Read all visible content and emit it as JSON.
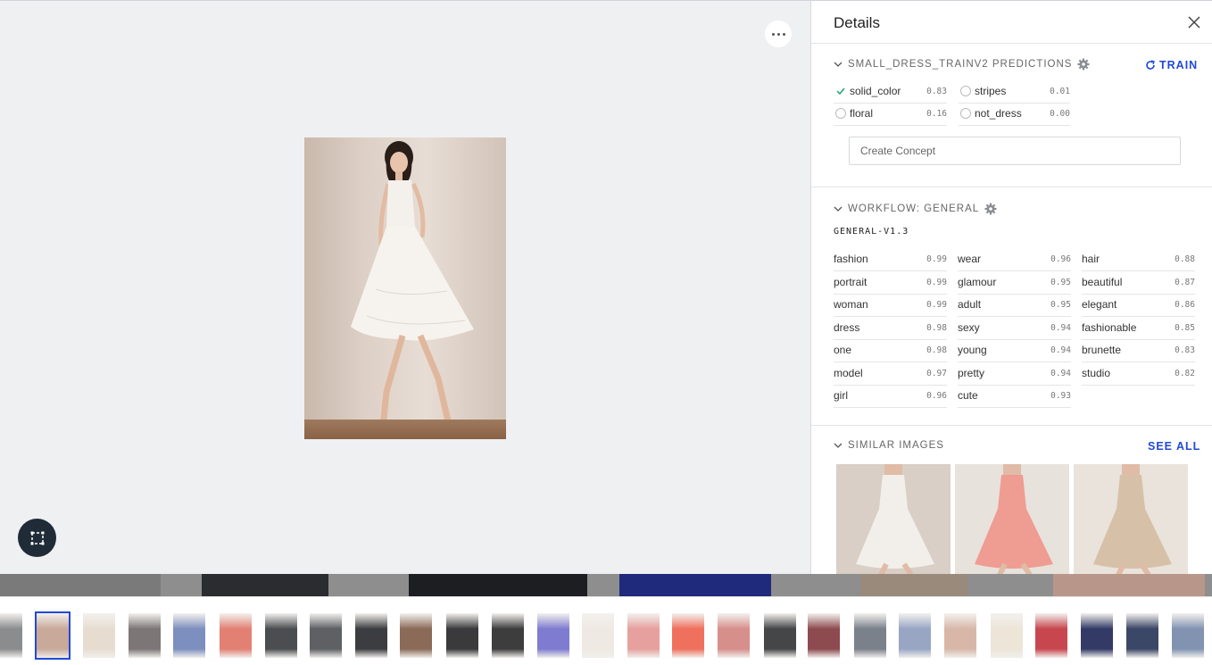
{
  "panel": {
    "title": "Details"
  },
  "predictions": {
    "header": "SMALL_DRESS_TRAINV2 PREDICTIONS",
    "train_label": "TRAIN",
    "items": [
      {
        "label": "solid_color",
        "value": "0.83",
        "checked": true
      },
      {
        "label": "stripes",
        "value": "0.01",
        "checked": false
      },
      {
        "label": "floral",
        "value": "0.16",
        "checked": false
      },
      {
        "label": "not_dress",
        "value": "0.00",
        "checked": false
      }
    ],
    "create_placeholder": "Create Concept"
  },
  "workflow": {
    "header": "WORKFLOW: GENERAL",
    "model": "GENERAL-V1.3",
    "columns": [
      [
        {
          "label": "fashion",
          "value": "0.99"
        },
        {
          "label": "portrait",
          "value": "0.99"
        },
        {
          "label": "woman",
          "value": "0.99"
        },
        {
          "label": "dress",
          "value": "0.98"
        },
        {
          "label": "one",
          "value": "0.98"
        },
        {
          "label": "model",
          "value": "0.97"
        },
        {
          "label": "girl",
          "value": "0.96"
        }
      ],
      [
        {
          "label": "wear",
          "value": "0.96"
        },
        {
          "label": "glamour",
          "value": "0.95"
        },
        {
          "label": "adult",
          "value": "0.95"
        },
        {
          "label": "sexy",
          "value": "0.94"
        },
        {
          "label": "young",
          "value": "0.94"
        },
        {
          "label": "pretty",
          "value": "0.94"
        },
        {
          "label": "cute",
          "value": "0.93"
        }
      ],
      [
        {
          "label": "hair",
          "value": "0.88"
        },
        {
          "label": "beautiful",
          "value": "0.87"
        },
        {
          "label": "elegant",
          "value": "0.86"
        },
        {
          "label": "fashionable",
          "value": "0.85"
        },
        {
          "label": "brunette",
          "value": "0.83"
        },
        {
          "label": "studio",
          "value": "0.82"
        }
      ]
    ]
  },
  "similar": {
    "header": "SIMILAR IMAGES",
    "see_all_label": "SEE ALL",
    "images": [
      {
        "icon": "white-lace-dress-photo",
        "bg": "#d9cfc6",
        "dress": "#f2efea"
      },
      {
        "icon": "pink-print-dress-photo",
        "bg": "#e8e2dc",
        "dress": "#ef9c93"
      },
      {
        "icon": "floral-lace-dress-photo",
        "bg": "#e9e3dc",
        "dress": "#d6c1a8"
      }
    ]
  },
  "colors": {
    "accent": "#2249d6",
    "check": "#1aa67a",
    "crop_button": "#1f2b37"
  },
  "filmstrip": {
    "selected_index": 1,
    "items": [
      {
        "icon": "gray-shoe-thumb",
        "color": "#8a8c8e"
      },
      {
        "icon": "white-dress-thumb",
        "color": "#c9a99a"
      },
      {
        "icon": "cream-dress-thumb",
        "color": "#e6ddd0"
      },
      {
        "icon": "pale-pink-dress-thumb",
        "color": "#7c7776"
      },
      {
        "icon": "blue-print-dress-thumb",
        "color": "#7d8fbf"
      },
      {
        "icon": "coral-dress-thumb",
        "color": "#e28073"
      },
      {
        "icon": "black-dress-thumb",
        "color": "#4b4d50"
      },
      {
        "icon": "gray-maxi-dress-thumb",
        "color": "#5e6064"
      },
      {
        "icon": "black-maxi-dress-thumb",
        "color": "#3c3d40"
      },
      {
        "icon": "brown-shoe-thumb",
        "color": "#8c6a58"
      },
      {
        "icon": "black-halter-dress-thumb",
        "color": "#3a3a3c"
      },
      {
        "icon": "black-boot-thumb",
        "color": "#3d3d3d"
      },
      {
        "icon": "periwinkle-dress-thumb",
        "color": "#7f7bd0"
      },
      {
        "icon": "white-shift-dress-thumb",
        "color": "#efe9e3"
      },
      {
        "icon": "pink-flare-dress-thumb",
        "color": "#e6a09d"
      },
      {
        "icon": "coral-sundress-thumb",
        "color": "#f0705e"
      },
      {
        "icon": "rose-shirt-dress-thumb",
        "color": "#d78f8b"
      },
      {
        "icon": "black-slip-dress-thumb",
        "color": "#444648"
      },
      {
        "icon": "burgundy-loafer-thumb",
        "color": "#8d4b4f"
      },
      {
        "icon": "gray-sneaker-thumb",
        "color": "#7b818a"
      },
      {
        "icon": "blue-mini-dress-thumb",
        "color": "#98a6c4"
      },
      {
        "icon": "beige-dress-thumb",
        "color": "#d8b7a9"
      },
      {
        "icon": "ivory-lace-dress-thumb",
        "color": "#ece5d8"
      },
      {
        "icon": "red-print-dress-thumb",
        "color": "#c8474f"
      },
      {
        "icon": "navy-dress-thumb",
        "color": "#333a66"
      },
      {
        "icon": "navy-tunic-dress-thumb",
        "color": "#3b4767"
      },
      {
        "icon": "chambray-dress-thumb",
        "color": "#8193b1"
      }
    ]
  },
  "peek_strip": [
    {
      "icon": "peek-image-1",
      "color": "#7a7a7a"
    },
    {
      "icon": "peek-image-2",
      "color": "#2b2c30"
    },
    {
      "icon": "peek-image-3",
      "color": "#1d1e22"
    },
    {
      "icon": "peek-image-4",
      "color": "#1f2a7d"
    },
    {
      "icon": "peek-image-5",
      "color": "#9a8a7c"
    },
    {
      "icon": "peek-image-6",
      "color": "#b8978a"
    }
  ]
}
